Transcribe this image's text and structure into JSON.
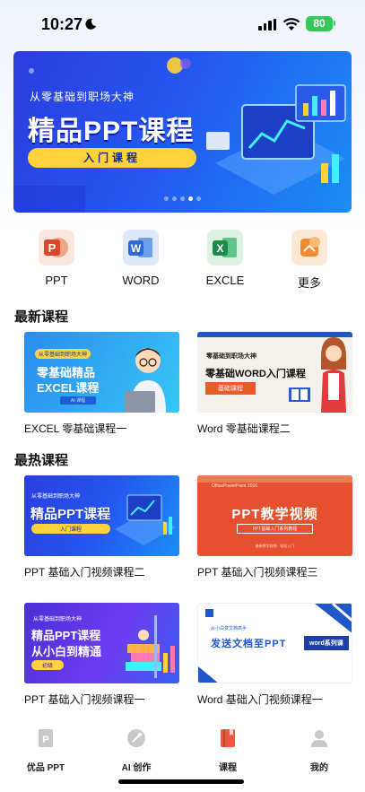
{
  "status_bar": {
    "time": "10:27",
    "battery": "80"
  },
  "banner": {
    "subtitle": "从零基础到职场大神",
    "title": "精品PPT课程",
    "pill": "入门课程",
    "slide_count": 5,
    "active_slide": 3
  },
  "categories": [
    {
      "label": "PPT",
      "icon": "ppt-icon",
      "color": "#e4572e"
    },
    {
      "label": "WORD",
      "icon": "word-icon",
      "color": "#2b6ad8"
    },
    {
      "label": "EXCLE",
      "icon": "excel-icon",
      "color": "#1f8a4c"
    },
    {
      "label": "更多",
      "icon": "more-icon",
      "color": "#f08a2c"
    }
  ],
  "sections": {
    "latest": {
      "title": "最新课程",
      "courses": [
        {
          "caption": "EXCEL 零基础课程一",
          "thumb": {
            "line1": "从零基础到职场大神",
            "line2": "零基础精品",
            "line3": "EXCEL课程",
            "tag": "AI 课程"
          }
        },
        {
          "caption": "Word 零基础课程二",
          "thumb": {
            "line1": "零基础到职场大神",
            "line2": "零基础WORD入门课程",
            "tag": "基础课程"
          }
        }
      ]
    },
    "hot": {
      "title": "最热课程",
      "courses": [
        {
          "caption": "PPT 基础入门视频课程二",
          "thumb": {
            "line1": "从零基础到职场大神",
            "line2": "精品PPT课程",
            "tag": "入门课程"
          }
        },
        {
          "caption": "PPT 基础入门视频课程三",
          "thumb": {
            "line1": "OfficePowerPoint 2016",
            "line2": "PPT教学视频",
            "tag": "PPT基础入门系列教程",
            "line3": "最新教学视频 · 轻松入门"
          }
        },
        {
          "caption": "PPT 基础入门视频课程一",
          "thumb": {
            "line1": "从零基础到职场大神",
            "line2": "精品PPT课程",
            "line3": "从小白到精通",
            "tag": "初级"
          }
        },
        {
          "caption": "Word 基础入门视频课程一",
          "thumb": {
            "line1": "从小白变文档高手",
            "line2": "发送文档至PPT",
            "tag": "word系列课"
          }
        }
      ]
    }
  },
  "tab_bar": [
    {
      "label": "优品 PPT",
      "icon": "ppt-doc-icon",
      "active": false
    },
    {
      "label": "AI 创作",
      "icon": "ai-create-icon",
      "active": false
    },
    {
      "label": "课程",
      "icon": "course-book-icon",
      "active": true
    },
    {
      "label": "我的",
      "icon": "profile-icon",
      "active": false
    }
  ],
  "colors": {
    "active_tab": "#e85b42",
    "inactive_tab": "#c9c9c9",
    "banner_blue": "#2456f0",
    "accent_yellow": "#ffd23c"
  }
}
